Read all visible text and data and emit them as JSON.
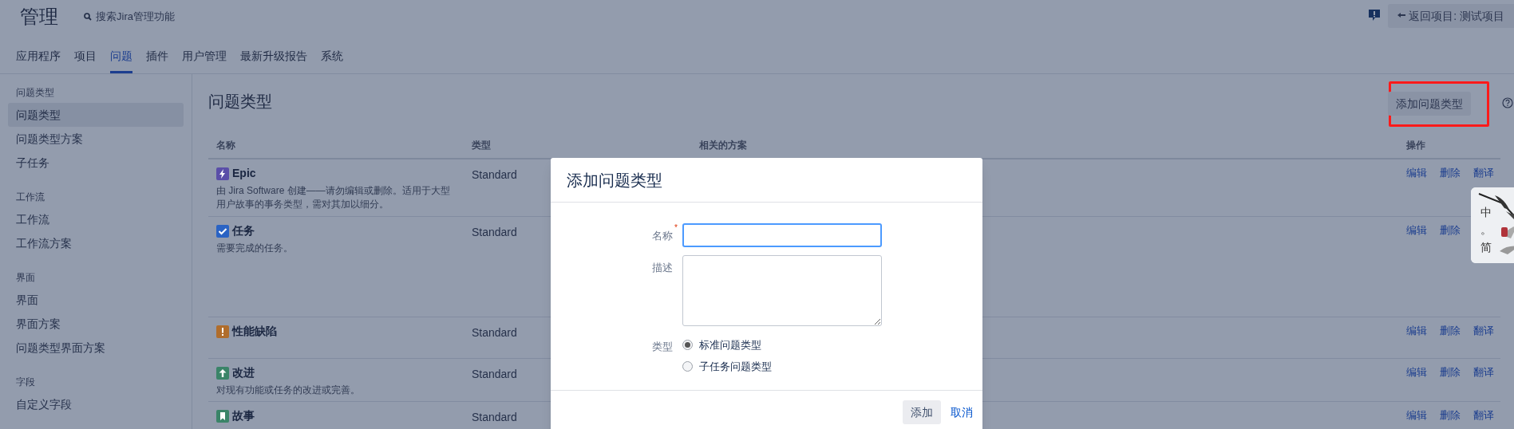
{
  "header": {
    "title": "管理",
    "search_placeholder": "搜索Jira管理功能",
    "back_button": "返回项目: 测试项目"
  },
  "nav_tabs": [
    {
      "label": "应用程序",
      "selected": false
    },
    {
      "label": "项目",
      "selected": false
    },
    {
      "label": "问题",
      "selected": true
    },
    {
      "label": "插件",
      "selected": false
    },
    {
      "label": "用户管理",
      "selected": false
    },
    {
      "label": "最新升级报告",
      "selected": false
    },
    {
      "label": "系统",
      "selected": false
    }
  ],
  "sidebar": {
    "groups": [
      {
        "heading": "问题类型",
        "items": [
          {
            "label": "问题类型",
            "selected": true
          },
          {
            "label": "问题类型方案",
            "selected": false
          },
          {
            "label": "子任务",
            "selected": false
          }
        ]
      },
      {
        "heading": "工作流",
        "items": [
          {
            "label": "工作流",
            "selected": false
          },
          {
            "label": "工作流方案",
            "selected": false
          }
        ]
      },
      {
        "heading": "界面",
        "items": [
          {
            "label": "界面",
            "selected": false
          },
          {
            "label": "界面方案",
            "selected": false
          },
          {
            "label": "问题类型界面方案",
            "selected": false
          }
        ]
      },
      {
        "heading": "字段",
        "items": [
          {
            "label": "自定义字段",
            "selected": false
          }
        ]
      }
    ]
  },
  "page": {
    "title": "问题类型",
    "add_button": "添加问题类型"
  },
  "table": {
    "columns": [
      "名称",
      "类型",
      "相关的方案",
      "操作"
    ],
    "rows": [
      {
        "kind": "epic",
        "name": "Epic",
        "description": "由 Jira Software 创建——请勿编辑或删除。适用于大型用户故事的事务类型，需对其加以细分。",
        "type": "Standard",
        "actions": [
          "编辑",
          "删除",
          "翻译"
        ]
      },
      {
        "kind": "task",
        "name": "任务",
        "description": "需要完成的任务。",
        "type": "Standard",
        "actions": [
          "编辑",
          "删除"
        ]
      },
      {
        "kind": "defect",
        "name": "性能缺陷",
        "type": "Standard",
        "actions": [
          "编辑",
          "删除",
          "翻译"
        ]
      },
      {
        "kind": "improvement",
        "name": "改进",
        "description": "对现有功能或任务的改进或完善。",
        "type": "Standard",
        "actions": [
          "编辑",
          "删除",
          "翻译"
        ]
      },
      {
        "kind": "story",
        "name": "故事",
        "type": "Standard",
        "actions": [
          "编辑",
          "删除",
          "翻译"
        ]
      }
    ]
  },
  "dialog": {
    "title": "添加问题类型",
    "fields": [
      {
        "kind": "text",
        "label": "名称",
        "required_mark": "*"
      },
      {
        "kind": "textarea",
        "label": "描述"
      },
      {
        "kind": "radio",
        "label": "类型",
        "options": [
          {
            "label": "标准问题类型",
            "selected": true
          },
          {
            "label": "子任务问题类型",
            "selected": false
          }
        ]
      }
    ],
    "submit": "添加",
    "cancel": "取消"
  },
  "ime_badge": {
    "chars": [
      "中",
      "。",
      "简"
    ]
  }
}
